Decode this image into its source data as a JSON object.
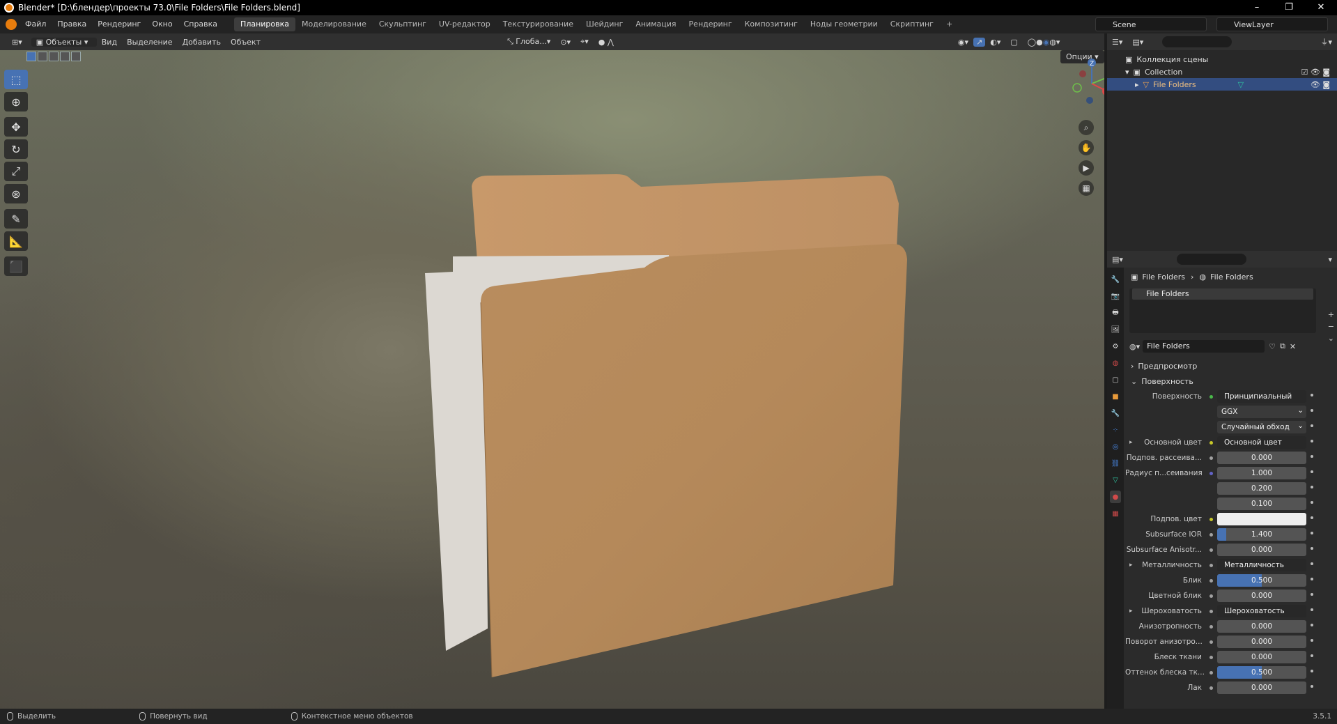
{
  "window": {
    "title": "Blender* [D:\\блендер\\проекты 73.0\\File Folders\\File Folders.blend]",
    "minimize": "–",
    "maximize": "❐",
    "close": "✕"
  },
  "menu": [
    "Файл",
    "Правка",
    "Рендеринг",
    "Окно",
    "Справка"
  ],
  "workspaces": [
    "Планировка",
    "Моделирование",
    "Скульптинг",
    "UV-редактор",
    "Текстурирование",
    "Шейдинг",
    "Анимация",
    "Рендеринг",
    "Композитинг",
    "Ноды геометрии",
    "Скриптинг",
    "+"
  ],
  "active_workspace": "Планировка",
  "scene": {
    "name": "Scene",
    "view_layer": "ViewLayer"
  },
  "viewport_header": {
    "mode": "Объекты",
    "view": "Вид",
    "select": "Выделение",
    "add": "Добавить",
    "object": "Объект",
    "transform": "Глоба...",
    "options": "Опции"
  },
  "gizmo": {
    "z": "Z",
    "y": "Y",
    "x": "X"
  },
  "outliner": {
    "root": "Коллекция сцены",
    "collection": "Collection",
    "object": "File Folders"
  },
  "properties": {
    "breadcrumb_object": "File Folders",
    "breadcrumb_material": "File Folders",
    "slot": "File Folders",
    "material_name": "File Folders",
    "panel_preview": "Предпросмотр",
    "panel_surface": "Поверхность",
    "rows": [
      {
        "label": "Поверхность",
        "value": "Принципиальный BSDF",
        "kind": "link",
        "dot": "green"
      },
      {
        "label": "",
        "value": "GGX",
        "kind": "dropdown"
      },
      {
        "label": "",
        "value": "Случайный обход",
        "kind": "dropdown"
      },
      {
        "label": "Основной цвет",
        "value": "Основной цвет",
        "kind": "link",
        "dot": "yellow",
        "expand": true
      },
      {
        "label": "Подпов. рассеива...",
        "value": "0.000",
        "kind": "num",
        "dot": "grey"
      },
      {
        "label": "Радиус п...сеивания",
        "value": "1.000",
        "kind": "num",
        "dot": "blue"
      },
      {
        "label": "",
        "value": "0.200",
        "kind": "num"
      },
      {
        "label": "",
        "value": "0.100",
        "kind": "num"
      },
      {
        "label": "Подпов. цвет",
        "value": "",
        "kind": "color",
        "dot": "yellow"
      },
      {
        "label": "Subsurface IOR",
        "value": "1.400",
        "kind": "num",
        "dot": "grey",
        "fill": 0.1
      },
      {
        "label": "Subsurface Anisotr...",
        "value": "0.000",
        "kind": "num",
        "dot": "grey"
      },
      {
        "label": "Металличность",
        "value": "Металличность",
        "kind": "link",
        "dot": "grey",
        "expand": true
      },
      {
        "label": "Блик",
        "value": "0.500",
        "kind": "num",
        "dot": "grey",
        "fill": 0.5
      },
      {
        "label": "Цветной блик",
        "value": "0.000",
        "kind": "num",
        "dot": "grey"
      },
      {
        "label": "Шероховатость",
        "value": "Шероховатость",
        "kind": "link",
        "dot": "grey",
        "expand": true
      },
      {
        "label": "Анизотропность",
        "value": "0.000",
        "kind": "num",
        "dot": "grey"
      },
      {
        "label": "Поворот анизотро...",
        "value": "0.000",
        "kind": "num",
        "dot": "grey"
      },
      {
        "label": "Блеск ткани",
        "value": "0.000",
        "kind": "num",
        "dot": "grey"
      },
      {
        "label": "Оттенок блеска тк...",
        "value": "0.500",
        "kind": "num",
        "dot": "grey",
        "fill": 0.5
      },
      {
        "label": "Лак",
        "value": "0.000",
        "kind": "num",
        "dot": "grey"
      }
    ]
  },
  "status": {
    "select": "Выделить",
    "rotate": "Повернуть вид",
    "context": "Контекстное меню объектов",
    "version": "3.5.1"
  },
  "colors": {
    "accent": "#4772b3",
    "folder": "#b5895a",
    "paper": "#dcd8d2"
  }
}
